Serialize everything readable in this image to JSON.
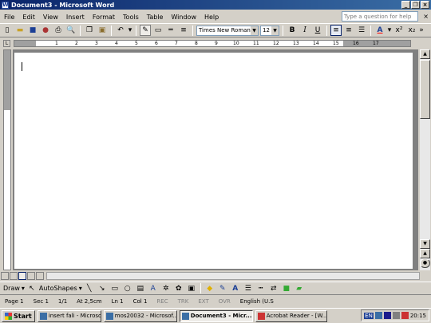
{
  "window": {
    "title": "Document3 - Microsoft Word"
  },
  "menu": {
    "items": [
      "File",
      "Edit",
      "View",
      "Insert",
      "Format",
      "Tools",
      "Table",
      "Window",
      "Help"
    ],
    "ask_placeholder": "Type a question for help"
  },
  "toolbar": {
    "font": "Times New Roman",
    "size": "12",
    "bold": "B",
    "italic": "I",
    "underline": "U"
  },
  "ruler": {
    "marks": [
      "1",
      "2",
      "3",
      "4",
      "5",
      "6",
      "7",
      "8",
      "9",
      "10",
      "11",
      "12",
      "13",
      "14",
      "15",
      "16",
      "17"
    ]
  },
  "drawbar": {
    "draw": "Draw",
    "autoshapes": "AutoShapes"
  },
  "status": {
    "page": "Page 1",
    "sec": "Sec 1",
    "pages": "1/1",
    "at": "At 2,5cm",
    "ln": "Ln 1",
    "col": "Col 1",
    "rec": "REC",
    "trk": "TRK",
    "ext": "EXT",
    "ovr": "OVR",
    "lang": "English (U.S"
  },
  "taskbar": {
    "start": "Start",
    "tasks": [
      "insert fali - Microsoft...",
      "mos20032 - Microsof...",
      "Document3 - Micr...",
      "Acrobat Reader - [W..."
    ],
    "lang": "EN",
    "time": "20:15"
  },
  "colors": {
    "title_start": "#0a246a",
    "title_end": "#3a6ea5",
    "chrome": "#d4d0c8"
  }
}
